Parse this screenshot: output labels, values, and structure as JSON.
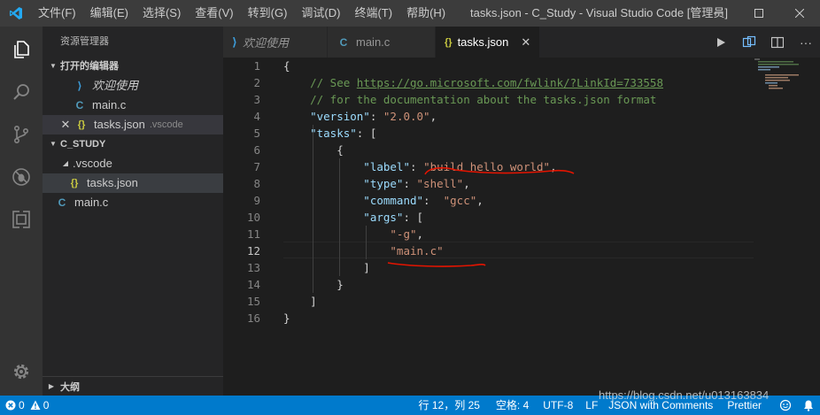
{
  "titlebar": {
    "menu": [
      "文件(F)",
      "编辑(E)",
      "选择(S)",
      "查看(V)",
      "转到(G)",
      "调试(D)",
      "终端(T)",
      "帮助(H)"
    ],
    "title": "tasks.json - C_Study - Visual Studio Code [管理员]",
    "controls": [
      "minimize-icon",
      "maximize-icon",
      "close-icon"
    ]
  },
  "activitybar": {
    "icons": [
      "files-icon",
      "search-icon",
      "source-control-icon",
      "debug-icon",
      "extensions-icon",
      "settings-gear-icon"
    ]
  },
  "sidebar": {
    "title": "资源管理器",
    "open_editors": {
      "label": "打开的编辑器",
      "items": [
        {
          "name": "欢迎使用",
          "italic": true
        },
        {
          "name": "main.c",
          "type": "c"
        },
        {
          "name": "tasks.json",
          "type": "json",
          "desc": ".vscode"
        }
      ]
    },
    "workspace": {
      "label": "C_STUDY",
      "folder": ".vscode",
      "folder_file": "tasks.json",
      "file": "main.c"
    },
    "outline": "大纲"
  },
  "tabs": [
    {
      "label": "欢迎使用",
      "italic": true
    },
    {
      "label": "main.c"
    },
    {
      "label": "tasks.json",
      "active": true
    }
  ],
  "editor": {
    "active_line": 12,
    "lines": [
      [
        {
          "t": "p",
          "v": "{"
        }
      ],
      [
        {
          "t": "c",
          "v": "    // See "
        },
        {
          "t": "url",
          "v": "https://go.microsoft.com/fwlink/?LinkId=733558"
        }
      ],
      [
        {
          "t": "c",
          "v": "    // for the documentation about the tasks.json format"
        }
      ],
      [
        {
          "t": "k",
          "v": "    \"version\""
        },
        {
          "t": "p",
          "v": ": "
        },
        {
          "t": "s",
          "v": "\"2.0.0\""
        },
        {
          "t": "p",
          "v": ","
        }
      ],
      [
        {
          "t": "k",
          "v": "    \"tasks\""
        },
        {
          "t": "p",
          "v": ": ["
        }
      ],
      [
        {
          "t": "p",
          "v": "        {"
        }
      ],
      [
        {
          "t": "k",
          "v": "            \"label\""
        },
        {
          "t": "p",
          "v": ": "
        },
        {
          "t": "s",
          "v": "\"build hello world\""
        },
        {
          "t": "p",
          "v": ","
        }
      ],
      [
        {
          "t": "k",
          "v": "            \"type\""
        },
        {
          "t": "p",
          "v": ": "
        },
        {
          "t": "s",
          "v": "\"shell\""
        },
        {
          "t": "p",
          "v": ","
        }
      ],
      [
        {
          "t": "k",
          "v": "            \"command\""
        },
        {
          "t": "p",
          "v": ":  "
        },
        {
          "t": "s",
          "v": "\"gcc\""
        },
        {
          "t": "p",
          "v": ","
        }
      ],
      [
        {
          "t": "k",
          "v": "            \"args\""
        },
        {
          "t": "p",
          "v": ": ["
        }
      ],
      [
        {
          "t": "s",
          "v": "                \"-g\""
        },
        {
          "t": "p",
          "v": ","
        }
      ],
      [
        {
          "t": "s",
          "v": "                \"main.c\""
        }
      ],
      [
        {
          "t": "p",
          "v": "            ]"
        }
      ],
      [
        {
          "t": "p",
          "v": "        }"
        }
      ],
      [
        {
          "t": "p",
          "v": "    ]"
        }
      ],
      [
        {
          "t": "p",
          "v": "}"
        }
      ]
    ]
  },
  "statusbar": {
    "errors": "0",
    "warnings": "0",
    "position": "行 12，列 25",
    "spaces": "空格: 4",
    "encoding": "UTF-8",
    "eol": "LF",
    "language": "JSON with Comments",
    "formatter": "Prettier"
  },
  "watermark": "https://blog.csdn.net/u013163834",
  "colors": {
    "accent": "#007acc",
    "annotation": "#e51400"
  }
}
